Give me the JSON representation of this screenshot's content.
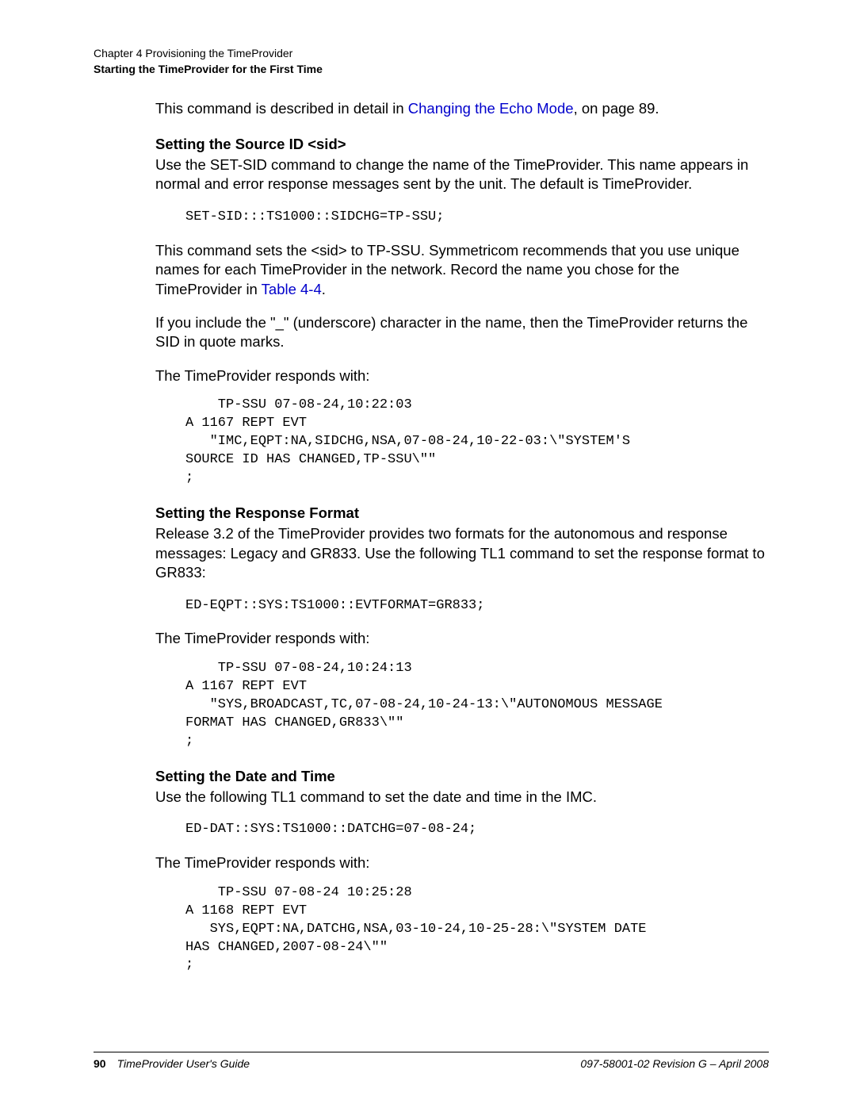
{
  "header": {
    "chapter": "Chapter 4 Provisioning the TimeProvider",
    "section": "Starting the TimeProvider for the First Time"
  },
  "body": {
    "intro_text1": "This command is described in detail in ",
    "intro_link": "Changing the Echo Mode",
    "intro_text2": ", on page 89.",
    "h1": "Setting the Source ID <sid>",
    "p1": "Use the SET-SID command to change the name of the TimeProvider. This name appears in normal and error response messages sent by the unit. The default is TimeProvider.",
    "code1": "SET-SID:::TS1000::SIDCHG=TP-SSU;",
    "p2a": "This command sets the <sid> to TP-SSU. Symmetricom recommends that you use unique names for each TimeProvider in the network. Record the name you chose for the TimeProvider in ",
    "p2_link": "Table 4-4",
    "p2b": ".",
    "p3": "If you include the \"_\" (underscore) character in the name, then the TimeProvider returns the SID in quote marks.",
    "p4": "The TimeProvider responds with:",
    "code2": "    TP-SSU 07-08-24,10:22:03\nA 1167 REPT EVT\n   \"IMC,EQPT:NA,SIDCHG,NSA,07-08-24,10-22-03:\\\"SYSTEM'S \nSOURCE ID HAS CHANGED,TP-SSU\\\"\"\n;",
    "h2": "Setting the Response Format",
    "p5": "Release 3.2 of the TimeProvider provides two formats for the autonomous and response messages: Legacy and GR833. Use the following TL1 command to set the response format to GR833:",
    "code3": "ED-EQPT::SYS:TS1000::EVTFORMAT=GR833;",
    "p6": "The TimeProvider responds with:",
    "code4": "    TP-SSU 07-08-24,10:24:13\nA 1167 REPT EVT\n   \"SYS,BROADCAST,TC,07-08-24,10-24-13:\\\"AUTONOMOUS MESSAGE \nFORMAT HAS CHANGED,GR833\\\"\"\n;",
    "h3": "Setting the Date and Time",
    "p7": "Use the following TL1 command to set the date and time in the IMC.",
    "code5": "ED-DAT::SYS:TS1000::DATCHG=07-08-24;",
    "p8": "The TimeProvider responds with:",
    "code6": "    TP-SSU 07-08-24 10:25:28\nA 1168 REPT EVT\n   SYS,EQPT:NA,DATCHG,NSA,03-10-24,10-25-28:\\\"SYSTEM DATE \nHAS CHANGED,2007-08-24\\\"\"\n;"
  },
  "footer": {
    "page": "90",
    "title": "TimeProvider User's Guide",
    "docid": "097-58001-02 Revision G – April 2008"
  }
}
